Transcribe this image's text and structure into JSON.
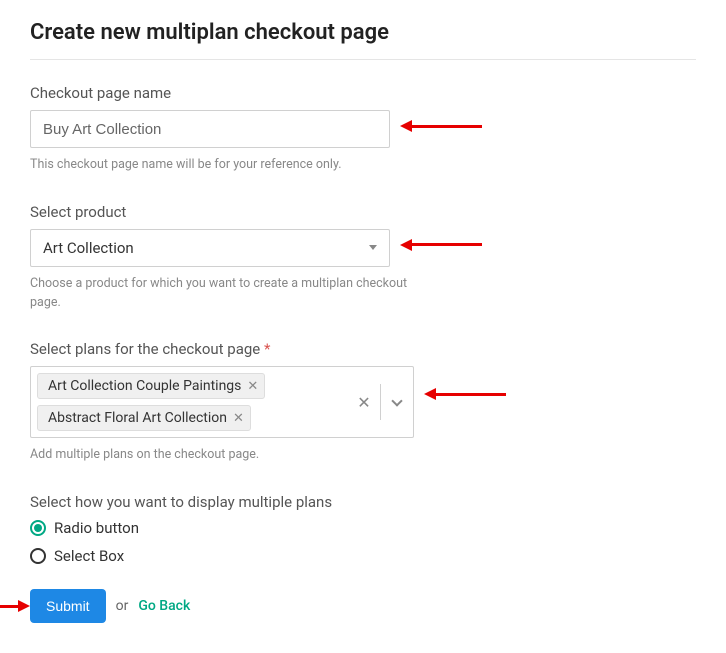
{
  "title": "Create new multiplan checkout page",
  "fields": {
    "checkout_name": {
      "label": "Checkout page name",
      "value": "Buy Art Collection",
      "help": "This checkout page name will be for your reference only."
    },
    "product": {
      "label": "Select product",
      "selected": "Art Collection",
      "help": "Choose a product for which you want to create a multiplan checkout page."
    },
    "plans": {
      "label": "Select plans for the checkout page",
      "chips": [
        "Art Collection Couple Paintings",
        "Abstract Floral Art Collection"
      ],
      "help": "Add multiple plans on the checkout page."
    },
    "display_mode": {
      "label": "Select how you want to display multiple plans",
      "options": [
        "Radio button",
        "Select Box"
      ],
      "selected": "Radio button"
    }
  },
  "actions": {
    "submit": "Submit",
    "or": "or",
    "go_back": "Go Back"
  }
}
